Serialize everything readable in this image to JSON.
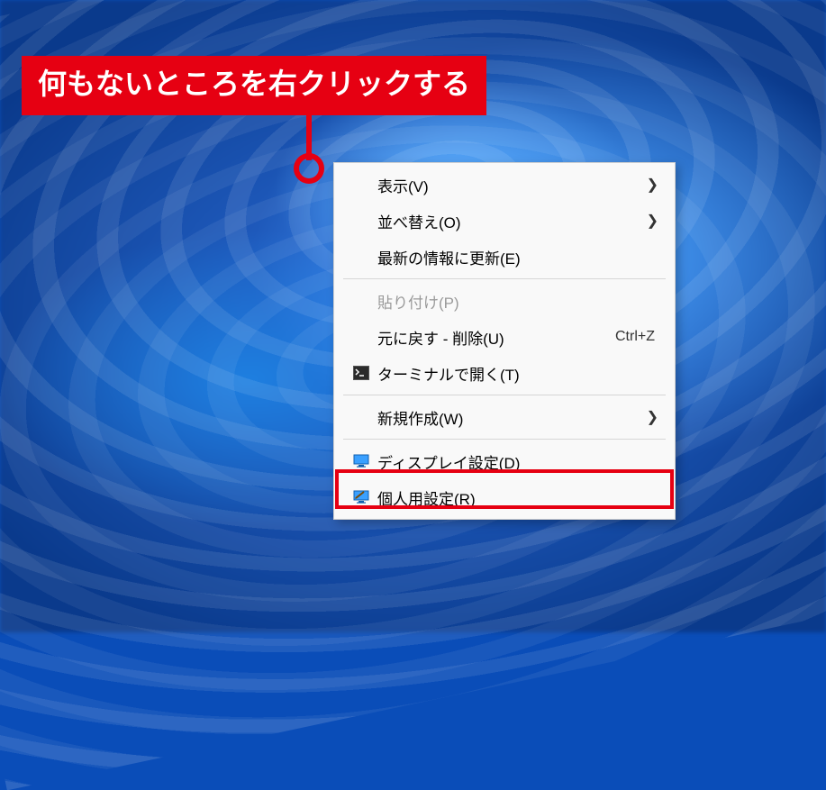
{
  "callout": {
    "text": "何もないところを右クリックする"
  },
  "menu": {
    "view": {
      "label": "表示(V)"
    },
    "sort": {
      "label": "並べ替え(O)"
    },
    "refresh": {
      "label": "最新の情報に更新(E)"
    },
    "paste": {
      "label": "貼り付け(P)"
    },
    "undo": {
      "label": "元に戻す - 削除(U)",
      "shortcut": "Ctrl+Z"
    },
    "terminal": {
      "label": "ターミナルで開く(T)"
    },
    "new": {
      "label": "新規作成(W)"
    },
    "display": {
      "label": "ディスプレイ設定(D)"
    },
    "personalize": {
      "label": "個人用設定(R)"
    }
  }
}
